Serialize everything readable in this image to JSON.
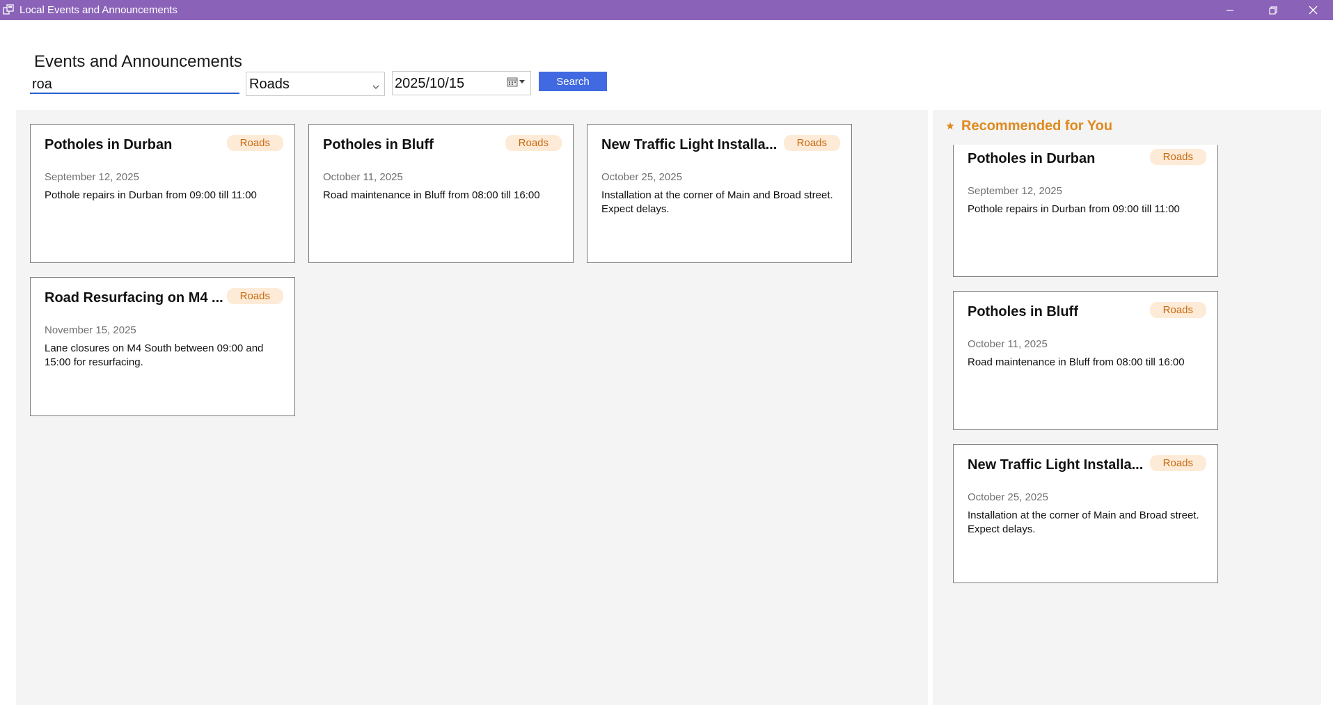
{
  "window": {
    "title": "Local Events and Announcements",
    "accent": "#8a63b9"
  },
  "header": {
    "title": "Events and Announcements",
    "search_value": "roa",
    "category_selected": "Roads",
    "date_value": "2025/10/15",
    "search_button": "Search"
  },
  "events": [
    {
      "title": "Potholes in Durban",
      "category": "Roads",
      "date": "September 12, 2025",
      "description": "Pothole repairs in Durban from 09:00 till 11:00"
    },
    {
      "title": "Potholes in Bluff",
      "category": "Roads",
      "date": "October 11, 2025",
      "description": "Road maintenance in Bluff from 08:00 till 16:00"
    },
    {
      "title": "New Traffic Light Installa...",
      "category": "Roads",
      "date": "October 25, 2025",
      "description": "Installation at the corner of Main and Broad street. Expect delays."
    },
    {
      "title": "Road Resurfacing on M4 ...",
      "category": "Roads",
      "date": "November 15, 2025",
      "description": "Lane closures on M4 South between 09:00 and 15:00 for resurfacing."
    }
  ],
  "recommended": {
    "header": "Recommended for You",
    "icon": "star-icon",
    "items": [
      {
        "title": "Potholes in Durban",
        "category": "Roads",
        "date": "September 12, 2025",
        "description": "Pothole repairs in Durban from 09:00 till 11:00"
      },
      {
        "title": "Potholes in Bluff",
        "category": "Roads",
        "date": "October 11, 2025",
        "description": "Road maintenance in Bluff from 08:00 till 16:00"
      },
      {
        "title": "New Traffic Light Installa...",
        "category": "Roads",
        "date": "October 25, 2025",
        "description": "Installation at the corner of Main and Broad street. Expect delays."
      }
    ]
  }
}
